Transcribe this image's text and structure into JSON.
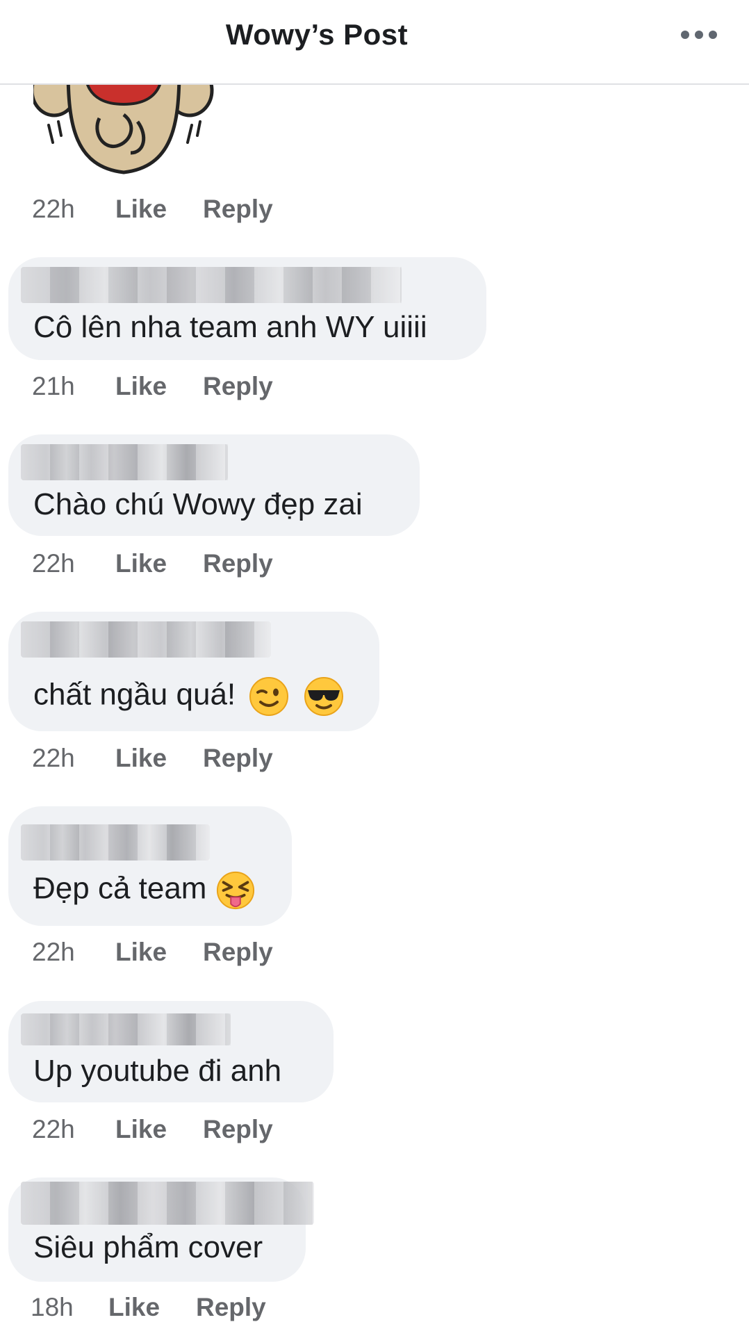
{
  "header": {
    "title": "Wowy’s Post"
  },
  "sticker_comment": {
    "time": "22h",
    "like": "Like",
    "reply": "Reply"
  },
  "comments": [
    {
      "text": "Cô lên nha team anh WY uiiii",
      "time": "21h",
      "like": "Like",
      "reply": "Reply"
    },
    {
      "text": "Chào chú Wowy đẹp zai",
      "time": "22h",
      "like": "Like",
      "reply": "Reply"
    },
    {
      "text": "chất ngầu quá!",
      "emojis": [
        "winking-face",
        "smiling-face-with-sunglasses"
      ],
      "time": "22h",
      "like": "Like",
      "reply": "Reply"
    },
    {
      "text": "Đẹp cả team",
      "emojis": [
        "squinting-face-with-tongue"
      ],
      "time": "22h",
      "like": "Like",
      "reply": "Reply"
    },
    {
      "text": "Up youtube đi anh",
      "time": "22h",
      "like": "Like",
      "reply": "Reply"
    },
    {
      "text": "Siêu phẩm cover",
      "time": "18h",
      "like": "Like",
      "reply": "Reply"
    }
  ],
  "colors": {
    "bubble": "#f0f2f5",
    "meta": "#65676b",
    "text": "#1c1e21",
    "divider": "#dfe0e4"
  }
}
